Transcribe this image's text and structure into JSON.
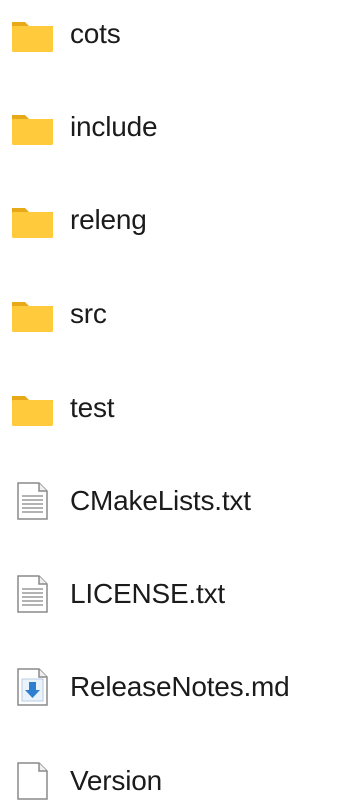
{
  "items": [
    {
      "name": "cots",
      "icon": "folder-icon",
      "type": "folder"
    },
    {
      "name": "include",
      "icon": "folder-icon",
      "type": "folder"
    },
    {
      "name": "releng",
      "icon": "folder-icon",
      "type": "folder"
    },
    {
      "name": "src",
      "icon": "folder-icon",
      "type": "folder"
    },
    {
      "name": "test",
      "icon": "folder-icon",
      "type": "folder"
    },
    {
      "name": "CMakeLists.txt",
      "icon": "text-file-icon",
      "type": "file"
    },
    {
      "name": "LICENSE.txt",
      "icon": "text-file-icon",
      "type": "file"
    },
    {
      "name": "ReleaseNotes.md",
      "icon": "markdown-file-icon",
      "type": "file"
    },
    {
      "name": "Version",
      "icon": "blank-file-icon",
      "type": "file"
    }
  ],
  "colors": {
    "folder_body": "#FFCB3D",
    "folder_tab": "#E8A918",
    "file_outline": "#8A8A8A",
    "download_arrow": "#2F7FD1"
  }
}
